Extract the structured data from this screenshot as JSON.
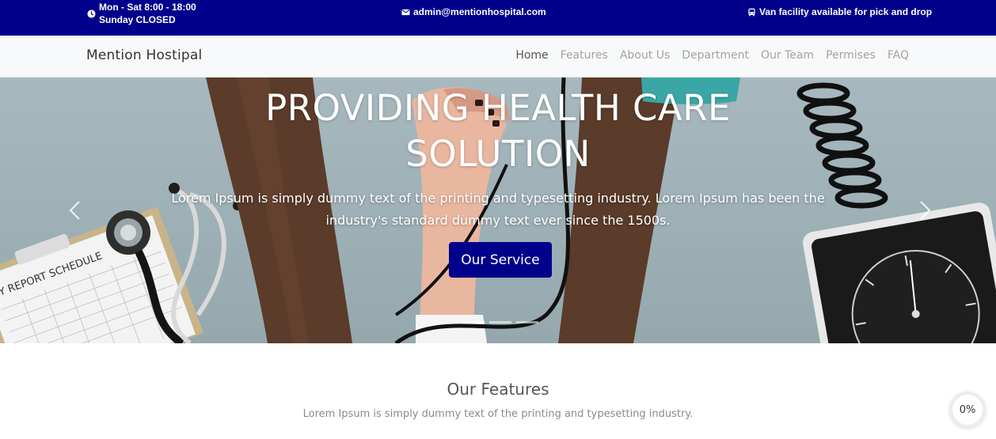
{
  "topbar": {
    "hours_line1": "Mon - Sat 8:00 - 18:00",
    "hours_line2": "Sunday CLOSED",
    "email": "admin@mentionhospital.com",
    "van": "Van facility available for pick and drop",
    "background_color": "#00008b"
  },
  "navbar": {
    "brand": "Mention Hostipal",
    "links": [
      "Home",
      "Features",
      "About Us",
      "Department",
      "Our Team",
      "Permises",
      "FAQ"
    ],
    "active_link": "Home"
  },
  "hero": {
    "title_line1": "PROVIDING HEALTH CARE",
    "title_line2": "SOLUTION",
    "subtitle_line1": "Lorem Ipsum is simply dummy text of the printing and typesetting industry. Lorem Ipsum has been the",
    "subtitle_line2": "industry's standard dummy text ever since the 1500s.",
    "button_label": "Our Service",
    "button_color": "#00008b",
    "clipboard_text": "Y REPORT SCHEDULE",
    "slide_count": 3,
    "active_slide": 1
  },
  "features": {
    "title": "Our Features",
    "subtitle": "Lorem Ipsum is simply dummy text of the printing and typesetting industry."
  },
  "progress": {
    "label": "0%",
    "value": 0
  },
  "icons": [
    "clock-icon",
    "envelope-icon",
    "bus-icon",
    "chevron-left-icon",
    "chevron-right-icon"
  ]
}
